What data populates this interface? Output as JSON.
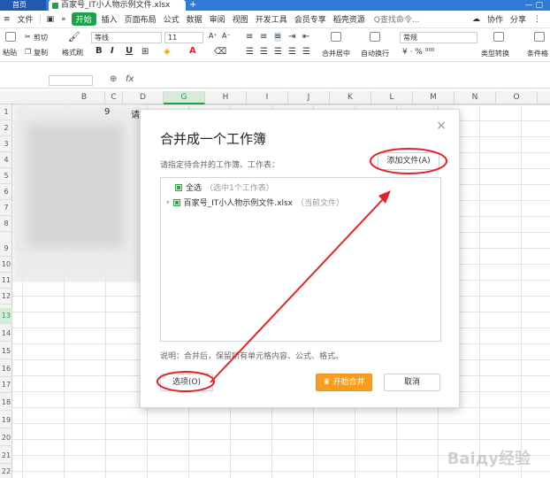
{
  "titlebar": {
    "left_tab": "首页",
    "doc_tab": "百家号_IT小人物示例文件.xlsx",
    "plus": "+"
  },
  "menubar": {
    "file": "文件",
    "start": "开始",
    "items": [
      "插入",
      "页面布局",
      "公式",
      "数据",
      "审阅",
      "视图",
      "开发工具",
      "会员专享",
      "稻壳资源"
    ],
    "search": "Q查找命令...",
    "collab": "协作",
    "share": "分享"
  },
  "ribbon": {
    "cut": "剪切",
    "paste": "粘贴",
    "copy": "复制",
    "format_painter": "格式刷",
    "font_name": "等线",
    "font_size": "11",
    "merge": "合并居中",
    "wrap": "自动换行",
    "number_format": "常规",
    "type_convert": "类型转换",
    "conditional": "条件格",
    "bold": "B",
    "italic": "I",
    "underline": "U",
    "font_color": "A"
  },
  "formula_bar": {
    "fx": "fx",
    "zoom": "⊕"
  },
  "grid": {
    "columns": [
      "B",
      "C",
      "D",
      "G",
      "H",
      "I",
      "J",
      "K",
      "L",
      "M",
      "N",
      "O"
    ],
    "rows": [
      "1",
      "2",
      "3",
      "4",
      "5",
      "6",
      "7",
      "8",
      "9",
      "10",
      "11",
      "12",
      "13",
      "14",
      "15",
      "16",
      "17",
      "18",
      "19",
      "20",
      "21",
      "22"
    ],
    "cell_fragments": [
      "9",
      "请"
    ]
  },
  "dialog": {
    "title": "合并成一个工作簿",
    "close": "×",
    "prompt": "请指定待合并的工作簿、工作表：",
    "add_file": "添加文件(A)",
    "select_all": "全选",
    "select_all_note": "（选中1个工作表）",
    "file_name": "百家号_IT小人物示例文件.xlsx",
    "file_note": "（当前文件）",
    "note": "说明：合并后，保留所有单元格内容、公式、格式。",
    "options": "选项(O)",
    "start_merge": "开始合并",
    "cancel": "取消"
  },
  "watermark": "Baiду经验",
  "colors": {
    "accent_green": "#1aa34a",
    "start_button": "#f79d1f",
    "annotation_red": "#e0242b",
    "tab_blue": "#2f7bd6"
  }
}
